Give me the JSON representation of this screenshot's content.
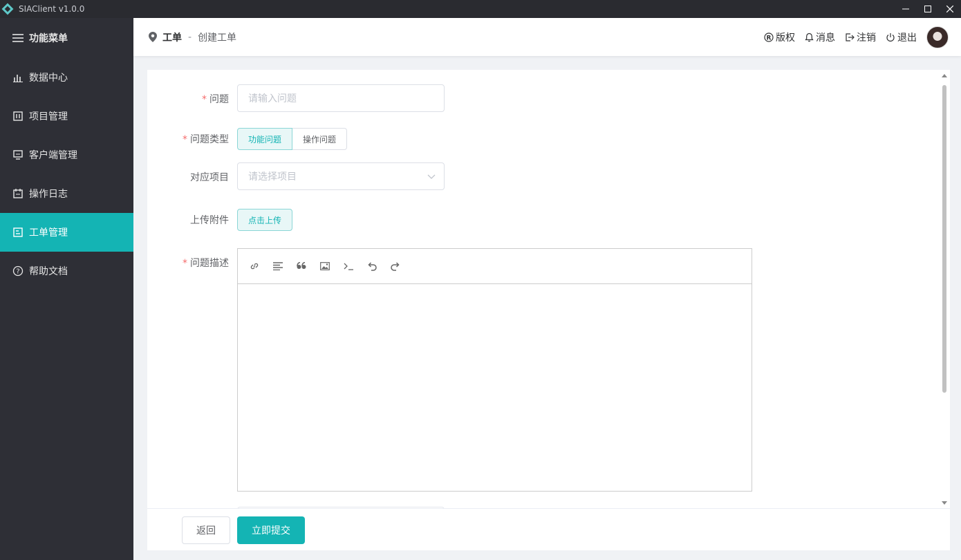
{
  "window": {
    "title": "SIAClient v1.0.0",
    "accent": "#14b4b4"
  },
  "sidebar": {
    "header": {
      "label": "功能菜单",
      "icon": "menu-icon"
    },
    "items": [
      {
        "label": "数据中心",
        "icon": "bar-chart-icon"
      },
      {
        "label": "项目管理",
        "icon": "project-icon"
      },
      {
        "label": "客户端管理",
        "icon": "monitor-icon"
      },
      {
        "label": "操作日志",
        "icon": "log-icon"
      },
      {
        "label": "工单管理",
        "icon": "ticket-icon",
        "active": true
      },
      {
        "label": "帮助文档",
        "icon": "help-icon"
      }
    ]
  },
  "header": {
    "breadcrumb": {
      "section": "工单",
      "separator": "-",
      "page": "创建工单"
    },
    "links": {
      "copyright": "版权",
      "messages": "消息",
      "logout": "注销",
      "exit": "退出"
    }
  },
  "form": {
    "question": {
      "label": "问题",
      "placeholder": "请输入问题"
    },
    "type": {
      "label": "问题类型",
      "options": [
        "功能问题",
        "操作问题"
      ],
      "selected": "功能问题"
    },
    "project": {
      "label": "对应项目",
      "placeholder": "请选择项目"
    },
    "attachment": {
      "label": "上传附件",
      "button": "点击上传"
    },
    "description": {
      "label": "问题描述"
    }
  },
  "footer": {
    "back": "返回",
    "submit": "立即提交"
  }
}
